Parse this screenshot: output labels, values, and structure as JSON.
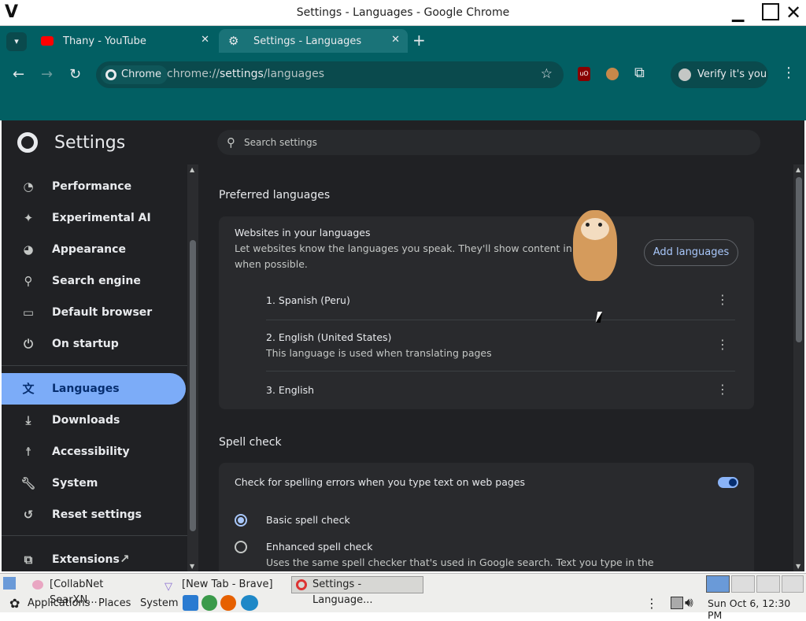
{
  "window": {
    "title": "Settings - Languages - Google Chrome"
  },
  "tabs": [
    {
      "label": "Thany - YouTube"
    },
    {
      "label": "Settings - Languages"
    }
  ],
  "omnibox": {
    "chip": "Chrome",
    "url_prefix": "chrome://",
    "url_host": "settings",
    "url_path": "/languages"
  },
  "profile": {
    "label": "Verify it's you"
  },
  "sidebar": {
    "title": "Settings",
    "items": [
      {
        "label": "Performance",
        "icon": "performance-icon"
      },
      {
        "label": "Experimental AI",
        "icon": "sparkle-icon"
      },
      {
        "label": "Appearance",
        "icon": "palette-icon"
      },
      {
        "label": "Search engine",
        "icon": "search-icon"
      },
      {
        "label": "Default browser",
        "icon": "browser-icon"
      },
      {
        "label": "On startup",
        "icon": "power-icon"
      },
      {
        "label": "Languages",
        "icon": "translate-icon"
      },
      {
        "label": "Downloads",
        "icon": "download-icon"
      },
      {
        "label": "Accessibility",
        "icon": "accessibility-icon"
      },
      {
        "label": "System",
        "icon": "wrench-icon"
      },
      {
        "label": "Reset settings",
        "icon": "reset-icon"
      },
      {
        "label": "Extensions",
        "icon": "puzzle-icon"
      }
    ]
  },
  "search": {
    "placeholder": "Search settings"
  },
  "preferred": {
    "heading": "Preferred languages",
    "card_title": "Websites in your languages",
    "card_desc_1": "Let websites know the languages you speak. They'll show content in those",
    "card_desc_2": "when possible.",
    "add_button": "Add languages",
    "languages": [
      {
        "name": "1. Spanish (Peru)",
        "note": ""
      },
      {
        "name": "2. English (United States)",
        "note": "This language is used when translating pages"
      },
      {
        "name": "3. English",
        "note": ""
      }
    ]
  },
  "spell": {
    "heading": "Spell check",
    "toggle_label": "Check for spelling errors when you type text on web pages",
    "toggle_on": true,
    "basic": "Basic spell check",
    "enhanced": "Enhanced spell check",
    "enhanced_desc": "Uses the same spell checker that's used in Google search. Text you type in the"
  },
  "taskbar": {
    "windows": [
      "[CollabNet SearXN...",
      "[New Tab - Brave]",
      "Settings - Language..."
    ],
    "menus": [
      "Applications",
      "Places",
      "System"
    ],
    "clock": "Sun Oct  6, 12:30 PM"
  },
  "colors": {
    "accent": "#7cacf8",
    "frame": "#025f63",
    "page_bg": "#202124"
  }
}
